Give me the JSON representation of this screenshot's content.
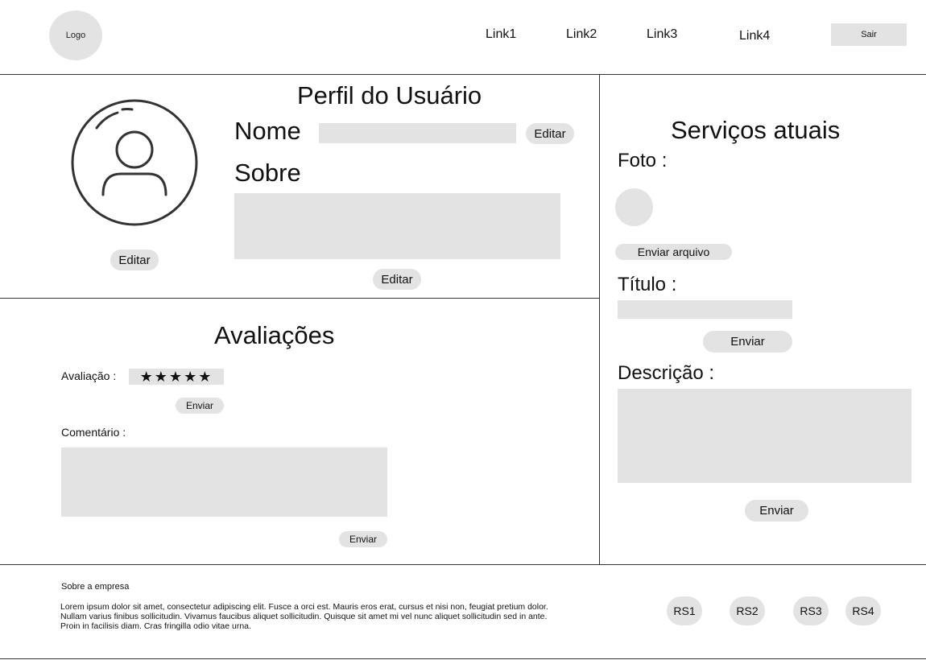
{
  "header": {
    "logo": "Logo",
    "nav": [
      "Link1",
      "Link2",
      "Link3",
      "Link4"
    ],
    "logout_label": "Sair"
  },
  "profile": {
    "title": "Perfil do Usuário",
    "name_label": "Nome",
    "name_value": "",
    "name_edit": "Editar",
    "about_label": "Sobre",
    "about_value": "",
    "about_edit": "Editar",
    "avatar_edit": "Editar"
  },
  "reviews": {
    "title": "Avaliações",
    "rating_label": "Avaliação :",
    "rating_stars": "★★★★★",
    "rating_value": 5,
    "rating_submit": "Enviar",
    "comment_label": "Comentário :",
    "comment_value": "",
    "comment_submit": "Enviar"
  },
  "services": {
    "title": "Serviços atuais",
    "photo_label": "Foto :",
    "upload_label": "Enviar arquivo",
    "title_label": "Título :",
    "title_value": "",
    "title_submit": "Enviar",
    "desc_label": "Descrição :",
    "desc_value": "",
    "desc_submit": "Enviar"
  },
  "footer": {
    "about_title": "Sobre a empresa",
    "about_text": "Lorem ipsum dolor sit amet, consectetur adipiscing elit. Fusce a orci est. Mauris eros erat, cursus et nisi non, feugiat pretium dolor. Nullam varius finibus sollicitudin. Vivamus faucibus aliquet sollicitudin. Quisque sit amet mi vel nunc aliquet sollicitudin sed in ante. Proin in facilisis diam. Cras fringilla odio vitae urna.",
    "social": [
      "RS1",
      "RS2",
      "RS3",
      "RS4"
    ]
  }
}
